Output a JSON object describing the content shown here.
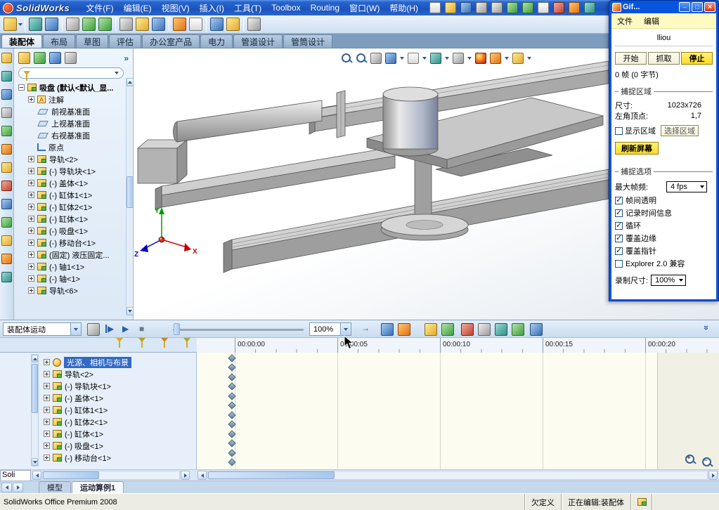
{
  "icons": {
    "play": "▶",
    "stop": "■",
    "step_mode_arrow": "→",
    "collapse_chevrons": "»",
    "flyout_chevrons": "»",
    "zoom_in_sign": "+",
    "zoom_out_sign": "−"
  },
  "titlebar": {
    "app_name": "SolidWorks",
    "menus": [
      "文件(F)",
      "编辑(E)",
      "视图(V)",
      "插入(I)",
      "工具(T)",
      "Toolbox",
      "Routing",
      "窗口(W)",
      "帮助(H)"
    ]
  },
  "command_tabs": [
    "装配体",
    "布局",
    "草图",
    "评估",
    "办公室产品",
    "电力",
    "管道设计",
    "管筒设计"
  ],
  "feature_tree": {
    "root_label": "吸盘 (默认<默认_显...",
    "items": [
      {
        "label": "注解"
      },
      {
        "label": "前视基准面"
      },
      {
        "label": "上视基准面"
      },
      {
        "label": "右视基准面"
      },
      {
        "label": "原点"
      },
      {
        "label": "导轨<2>"
      },
      {
        "label": "(-) 导轨块<1>"
      },
      {
        "label": "(-) 盖体<1>"
      },
      {
        "label": "(-) 缸体1<1>"
      },
      {
        "label": "(-) 缸体2<1>"
      },
      {
        "label": "(-) 缸体<1>"
      },
      {
        "label": "(-) 吸盘<1>"
      },
      {
        "label": "(-) 移动台<1>"
      },
      {
        "label": "(固定) 液压固定..."
      },
      {
        "label": "(-) 轴1<1>"
      },
      {
        "label": "(-) 轴<1>"
      },
      {
        "label": "导轨<6>"
      }
    ]
  },
  "viewport": {
    "triad": {
      "x_label": "X",
      "y_label": "Y",
      "z_label": "Z"
    }
  },
  "gif_window": {
    "title": "Gif...",
    "menu_items": [
      "文件",
      "编辑"
    ],
    "filename": "lliou",
    "start_button": "开始",
    "grab_button": "抓取",
    "stop_button": "停止",
    "frame_status": "0 帧 (0 字节)",
    "capture_area": {
      "title": "捕捉区域",
      "size_label": "尺寸:",
      "size_value": "1023x726",
      "origin_label": "左角顶点:",
      "origin_value": "1,7",
      "show_area_label": "显示区域",
      "select_area_button": "选择区域",
      "refresh_button": "刷新屏幕"
    },
    "capture_options": {
      "title": "捕捉选项",
      "fps_label": "最大帧频:",
      "fps_value": "4 fps",
      "checkboxes": [
        {
          "label": "帧间透明",
          "checked": true
        },
        {
          "label": "记录时间信息",
          "checked": true
        },
        {
          "label": "循环",
          "checked": true
        },
        {
          "label": "覆盖边缘",
          "checked": true
        },
        {
          "label": "覆盖指针",
          "checked": true
        },
        {
          "label": "Explorer 2.0 兼容",
          "checked": false
        }
      ],
      "record_size_label": "录制尺寸:",
      "record_size_value": "100%"
    }
  },
  "motion": {
    "study_type_value": "装配体运动",
    "playback_speed_value": "100%",
    "ticks": [
      "00:00:00",
      "00:00:05",
      "00:00:10",
      "00:00:15",
      "00:00:20"
    ],
    "tree_items": [
      {
        "label": "光源、相机与布景"
      },
      {
        "label": "导轨<2>"
      },
      {
        "label": "(-) 导轨块<1>"
      },
      {
        "label": "(-) 盖体<1>"
      },
      {
        "label": "(-) 缸体1<1>"
      },
      {
        "label": "(-) 缸体2<1>"
      },
      {
        "label": "(-) 缸体<1>"
      },
      {
        "label": "(-) 吸盘<1>"
      },
      {
        "label": "(-) 移动台<1>"
      }
    ],
    "corner_text": "Soli",
    "tabs": [
      "模型",
      "运动算例1"
    ]
  },
  "status_bar": {
    "product": "SolidWorks Office Premium 2008",
    "definition_state": "欠定义",
    "editing_state": "正在编辑:装配体"
  }
}
